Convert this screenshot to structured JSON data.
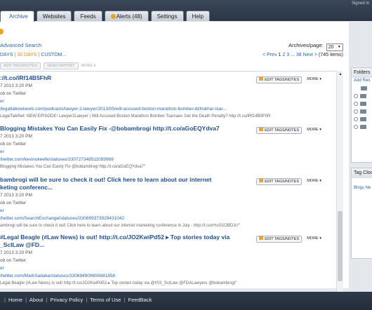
{
  "header": {
    "signed_in": "Signed in",
    "tabs": [
      {
        "label": "Archive",
        "active": true
      },
      {
        "label": "Websites"
      },
      {
        "label": "Feeds"
      },
      {
        "label": "Alerts (48)"
      },
      {
        "label": "Settings"
      },
      {
        "label": "Help"
      }
    ]
  },
  "filters": {
    "advanced_search": "Advanced Search",
    "days_a": "DAYS",
    "days_b": "30 DAYS",
    "days_c": "CUSTOM...",
    "archives_label": "Archives/page:",
    "per_page": "20",
    "pager_prev": "< Prev",
    "pager_p1": "1",
    "pager_p2": "2",
    "pager_p3": "3",
    "pager_ellipsis": "...",
    "pager_last": "38",
    "pager_next": "Next >",
    "pager_total": "(745 items)"
  },
  "toolbar": {
    "add_tags": "ADD TAGS/NOTES",
    "send_report": "SEND REPORT",
    "more": "MORE"
  },
  "entries": [
    {
      "title": "://t.co/lRf14B5FhR",
      "date": "7 2013 3:20 PM",
      "source": "ob on Twitter",
      "type": "er",
      "url": "/legaltalknetwork.com/podcasts/lawyer-2-lawyer/2013/05/will-accused-boston-marathon-bomber-dzhokhar-tsar...",
      "text": "LegalTalkNet: NEW EPISODE! Lawyer2Lawyer | Will Accused Boston Marathon Bomber Tsarnaev Get the Death Penalty? http://t.co/lRf14B5FhR"
    },
    {
      "title": "Blogging Mistakes You Can Easily Fix -@bobambrogi http://t.co/aGoEQYdva7",
      "date": "7 2013 3:20 PM",
      "source": "ob on Twitter",
      "type": "er",
      "url": "/twitter.com/kevinokeefe/statuses/330727348511059969",
      "text": "Blogging Mistakes You Can Easily Fix @bobambrogi http://t.co/aGoEQYdva7\""
    },
    {
      "title": "bambrogi will be sure to check it out! Click here to learn about our internet",
      "title2": "keting conferenc...",
      "date": "7 2013 3:20 PM",
      "source": "ob on Twitter",
      "type": "er",
      "url": "/twitter.com/SearchExchange/statuses/330699373929431042",
      "text": "ambrogi will be sure to check it out! Click here to learn about our internet marketing conference in July - http://t.co/rHuS1OBDJc!\""
    },
    {
      "title": "#Legal Beagle (#Law News) is out! http://t.co/JO2KwiPd52 ▸ Top stories today via",
      "title2": "_ScILaw @FD...",
      "date": "7 2013 3:20 PM",
      "source": "ob on Twitter",
      "type": "er",
      "url": "/twitter.com/MarkSadaka/statuses/330694909650681858",
      "text": "Legal Beagle (#Law News) is out! http://t.co/JO2KwiPd52 ▸ Top stories today via @ISS_ScILaw @FDALawyers @bobambrogi\""
    }
  ],
  "entry_buttons": {
    "edit": "EDIT TAGS/NOTES",
    "more": "MORE"
  },
  "sidebar": {
    "folders_title": "Folders",
    "folders_add": "Add",
    "folders_rename": "Ren",
    "tags_title": "Tag Clou",
    "tags_blogs": "Blogs",
    "tags_news": "Ne"
  },
  "footer": {
    "links": [
      "Home",
      "About",
      "Privacy Policy",
      "Terms of Use",
      "FeedBack"
    ]
  },
  "colors": {
    "accent": "#f0a020",
    "link": "#2a66b5",
    "header": "#2b3645"
  }
}
